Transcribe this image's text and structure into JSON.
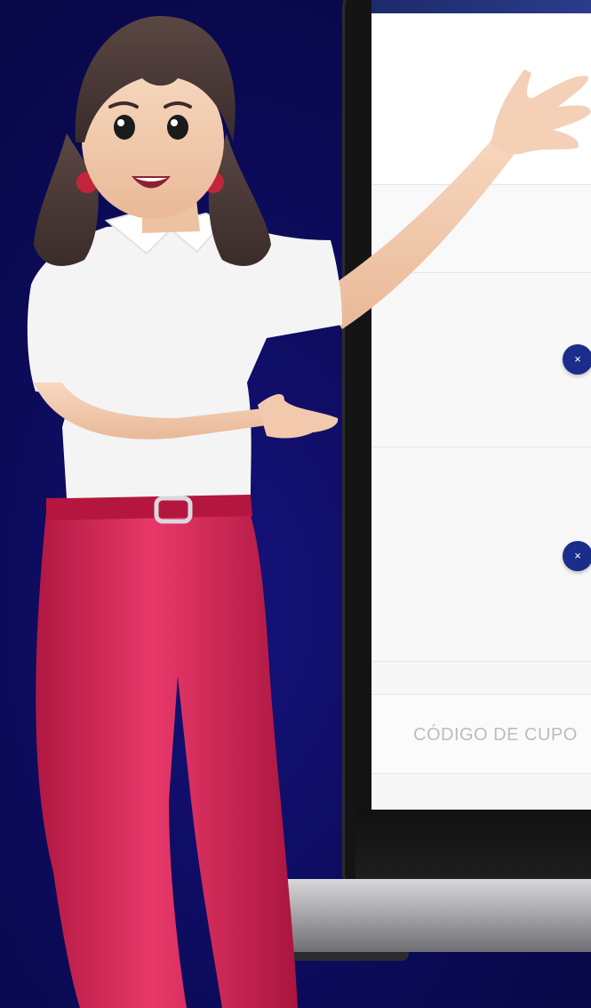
{
  "colors": {
    "background": "#0b0a55",
    "accent": "#1a2d8a",
    "pants": "#d8285a",
    "shirt": "#f2f2f2"
  },
  "cart": {
    "remove_icon": "×",
    "coupon_label": "CÓDIGO DE CUPO"
  },
  "icons": [
    "close-icon"
  ]
}
